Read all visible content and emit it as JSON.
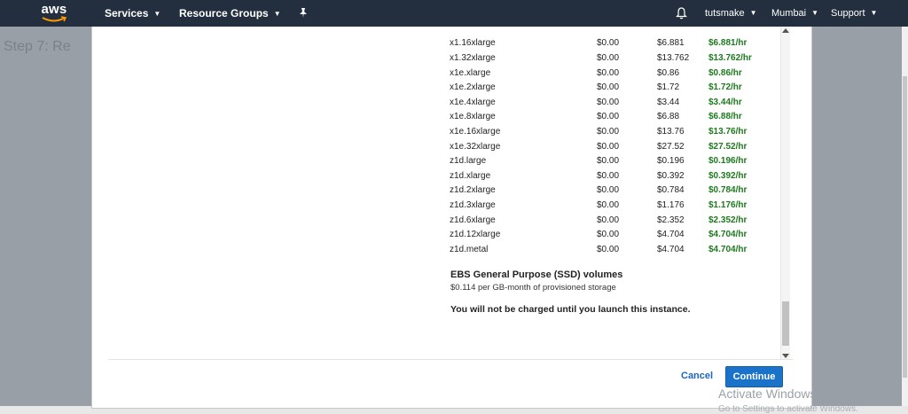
{
  "topnav": {
    "logo": "aws",
    "services": "Services",
    "resource_groups": "Resource Groups",
    "pin_icon": "pin-icon",
    "bell_icon": "bell-icon",
    "user": "tutsmake",
    "region": "Mumbai",
    "support": "Support"
  },
  "background": {
    "step_text": "Step 7: Re"
  },
  "pricing": {
    "rows": [
      {
        "type": "x1.16xlarge",
        "on_demand": "$0.00",
        "cost": "$6.881",
        "rate": "$6.881/hr"
      },
      {
        "type": "x1.32xlarge",
        "on_demand": "$0.00",
        "cost": "$13.762",
        "rate": "$13.762/hr"
      },
      {
        "type": "x1e.xlarge",
        "on_demand": "$0.00",
        "cost": "$0.86",
        "rate": "$0.86/hr"
      },
      {
        "type": "x1e.2xlarge",
        "on_demand": "$0.00",
        "cost": "$1.72",
        "rate": "$1.72/hr"
      },
      {
        "type": "x1e.4xlarge",
        "on_demand": "$0.00",
        "cost": "$3.44",
        "rate": "$3.44/hr"
      },
      {
        "type": "x1e.8xlarge",
        "on_demand": "$0.00",
        "cost": "$6.88",
        "rate": "$6.88/hr"
      },
      {
        "type": "x1e.16xlarge",
        "on_demand": "$0.00",
        "cost": "$13.76",
        "rate": "$13.76/hr"
      },
      {
        "type": "x1e.32xlarge",
        "on_demand": "$0.00",
        "cost": "$27.52",
        "rate": "$27.52/hr"
      },
      {
        "type": "z1d.large",
        "on_demand": "$0.00",
        "cost": "$0.196",
        "rate": "$0.196/hr"
      },
      {
        "type": "z1d.xlarge",
        "on_demand": "$0.00",
        "cost": "$0.392",
        "rate": "$0.392/hr"
      },
      {
        "type": "z1d.2xlarge",
        "on_demand": "$0.00",
        "cost": "$0.784",
        "rate": "$0.784/hr"
      },
      {
        "type": "z1d.3xlarge",
        "on_demand": "$0.00",
        "cost": "$1.176",
        "rate": "$1.176/hr"
      },
      {
        "type": "z1d.6xlarge",
        "on_demand": "$0.00",
        "cost": "$2.352",
        "rate": "$2.352/hr"
      },
      {
        "type": "z1d.12xlarge",
        "on_demand": "$0.00",
        "cost": "$4.704",
        "rate": "$4.704/hr"
      },
      {
        "type": "z1d.metal",
        "on_demand": "$0.00",
        "cost": "$4.704",
        "rate": "$4.704/hr"
      }
    ],
    "ebs_title": "EBS General Purpose (SSD) volumes",
    "ebs_desc": "$0.114 per GB-month of provisioned storage",
    "notice": "You will not be charged until you launch this instance."
  },
  "buttons": {
    "cancel": "Cancel",
    "continue": "Continue"
  },
  "watermark": {
    "line1": "Activate Windows",
    "line2": "Go to Settings to activate Windows."
  },
  "colors": {
    "nav_bg": "#232f3e",
    "rate_green": "#1d7a1d",
    "primary_blue": "#1a73c8"
  }
}
